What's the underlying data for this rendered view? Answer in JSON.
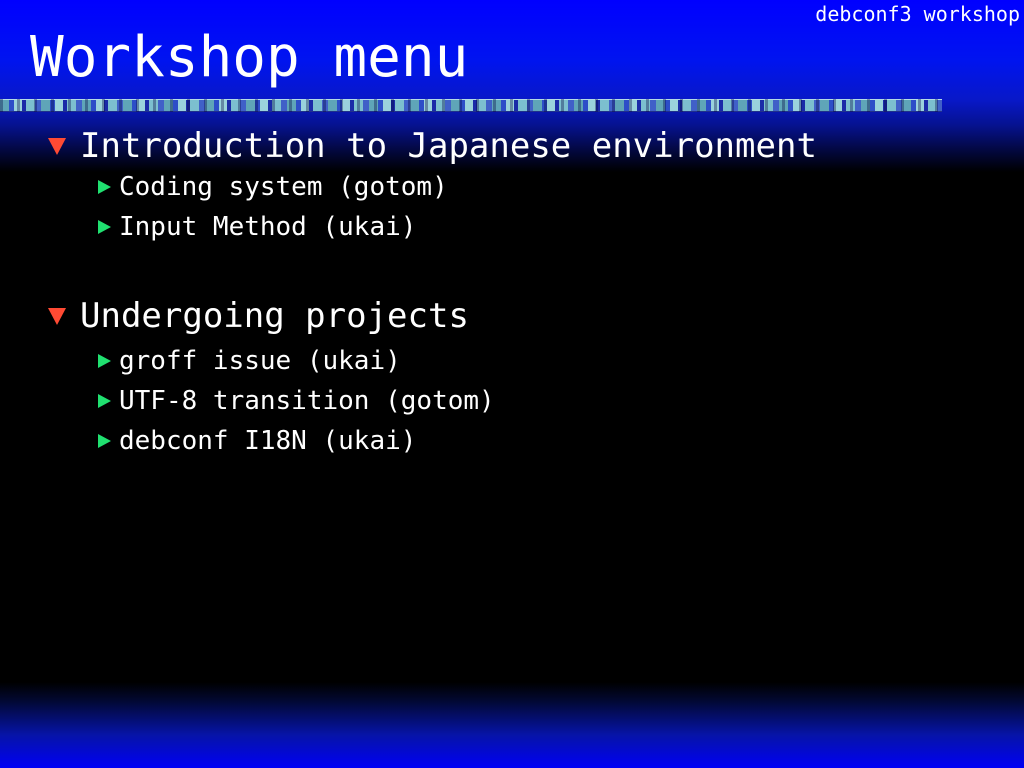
{
  "slide": {
    "header_caption": "debconf3 workshop",
    "title": "Workshop menu"
  },
  "sections": [
    {
      "label": "Introduction to Japanese environment",
      "items": [
        "Coding system (gotom)",
        "Input Method (ukai)"
      ]
    },
    {
      "label": "Undergoing projects",
      "items": [
        "groff issue (ukai)",
        "UTF-8 transition (gotom)",
        "debconf I18N (ukai)"
      ]
    }
  ],
  "icons": {
    "section_marker": "triangle-down-icon",
    "item_marker": "triangle-right-icon"
  },
  "colors": {
    "header_blue": "#0000ff",
    "section_marker": "#ff4a33",
    "item_marker": "#20e070",
    "text": "#ffffff"
  }
}
